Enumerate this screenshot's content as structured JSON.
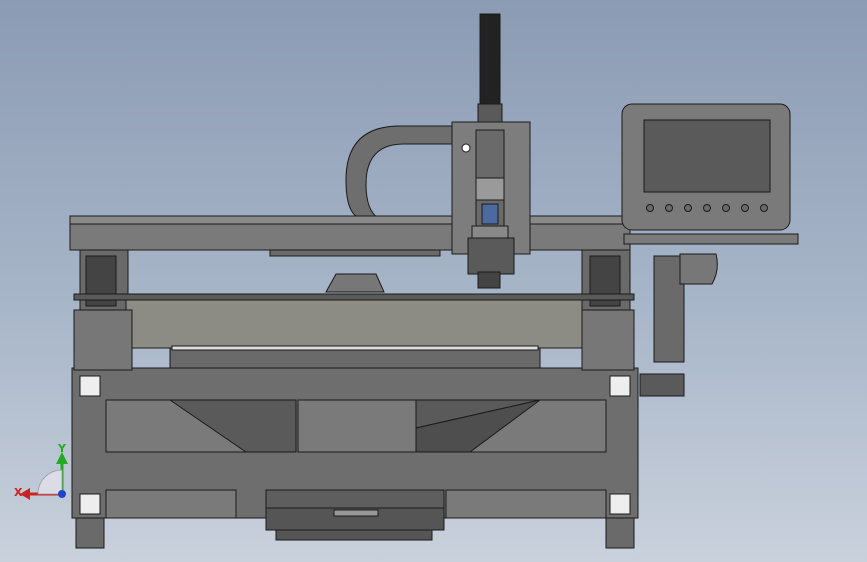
{
  "viewport": {
    "background_top": "#8b9bb3",
    "background_bottom": "#c9d1dc",
    "line_color": "#1a1a1a",
    "part_color": "#6e6e6e",
    "part_dark": "#4a4a4a",
    "part_light": "#8c8c84",
    "bed_color": "#7d7d77",
    "screen_color": "#5a5a5a"
  },
  "triad": {
    "x_label": "X",
    "y_label": "Y",
    "x_color": "#cc2222",
    "y_color": "#22aa22",
    "z_color": "#2244cc"
  },
  "control_panel": {
    "button_count": 7
  }
}
